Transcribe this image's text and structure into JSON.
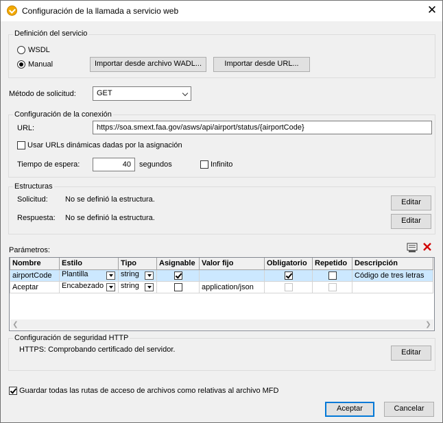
{
  "window": {
    "title": "Configuración de la llamada a servicio web",
    "close_glyph": "✕"
  },
  "service_def": {
    "legend": "Definición del servicio",
    "wsdl_label": "WSDL",
    "manual_label": "Manual",
    "import_wadl_label": "Importar desde archivo WADL...",
    "import_url_label": "Importar desde URL...",
    "selected": "manual"
  },
  "request_method": {
    "label": "Método de solicitud:",
    "value": "GET"
  },
  "connection": {
    "legend": "Configuración de la conexión",
    "url_label": "URL:",
    "url_value": "https://soa.smext.faa.gov/asws/api/airport/status/{airportCode}",
    "dynamic_urls_label": "Usar URLs dinámicas dadas por la asignación",
    "dynamic_urls_checked": false,
    "timeout_label": "Tiempo de espera:",
    "timeout_value": "40",
    "timeout_unit": "segundos",
    "infinite_label": "Infinito",
    "infinite_checked": false
  },
  "structures": {
    "legend": "Estructuras",
    "request_label": "Solicitud:",
    "request_value": "No se definió la estructura.",
    "response_label": "Respuesta:",
    "response_value": "No se definió la estructura.",
    "edit_label": "Editar"
  },
  "parameters": {
    "label": "Parámetros:",
    "columns": [
      "Nombre",
      "Estilo",
      "Tipo",
      "Asignable",
      "Valor fijo",
      "Obligatorio",
      "Repetido",
      "Descripción"
    ],
    "rows": [
      {
        "name": "airportCode",
        "style": "Plantilla",
        "type": "string",
        "assignable": true,
        "fixed": "",
        "required": true,
        "required_disabled": false,
        "repeated": false,
        "repeated_disabled": false,
        "description": "Código de tres letras",
        "selected": true
      },
      {
        "name": "Aceptar",
        "style": "Encabezado",
        "type": "string",
        "assignable": false,
        "fixed": "application/json",
        "required": false,
        "required_disabled": true,
        "repeated": false,
        "repeated_disabled": true,
        "description": "",
        "selected": false
      }
    ]
  },
  "security": {
    "legend": "Configuración de seguridad HTTP",
    "status": "HTTPS: Comprobando certificado del servidor.",
    "edit_label": "Editar"
  },
  "save_relative": {
    "label": "Guardar todas las rutas de acceso de archivos como relativas al archivo MFD",
    "checked": true
  },
  "footer": {
    "ok_label": "Aceptar",
    "cancel_label": "Cancelar"
  }
}
